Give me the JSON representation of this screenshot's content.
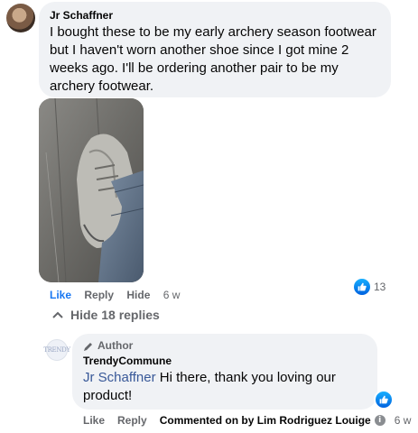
{
  "comment": {
    "author": "Jr Schaffner",
    "text": "I bought these to be my early archery season footwear but I haven't worn another shoe since I got mine 2 weeks ago. I'll be ordering another pair to be my archery footwear.",
    "actions": {
      "like": "Like",
      "reply": "Reply",
      "hide": "Hide",
      "time": "6 w"
    },
    "reactions": {
      "count": "13",
      "icon": "like-icon",
      "color": "#1877f2"
    }
  },
  "replies_toggle": {
    "label": "Hide 18 replies",
    "icon": "chevron-up-icon"
  },
  "reply": {
    "avatar_text": "TRENDY",
    "badge": "Author",
    "badge_icon": "pencil-icon",
    "author": "TrendyCommune",
    "mention": "Jr Schaffner",
    "text": " Hi there, thank you loving our product!",
    "actions": {
      "like": "Like",
      "reply": "Reply",
      "commented_prefix": "Commented on by ",
      "commented_name": "Lim Rodriguez Louige",
      "info_icon": "info-icon",
      "time": "6 w"
    }
  }
}
